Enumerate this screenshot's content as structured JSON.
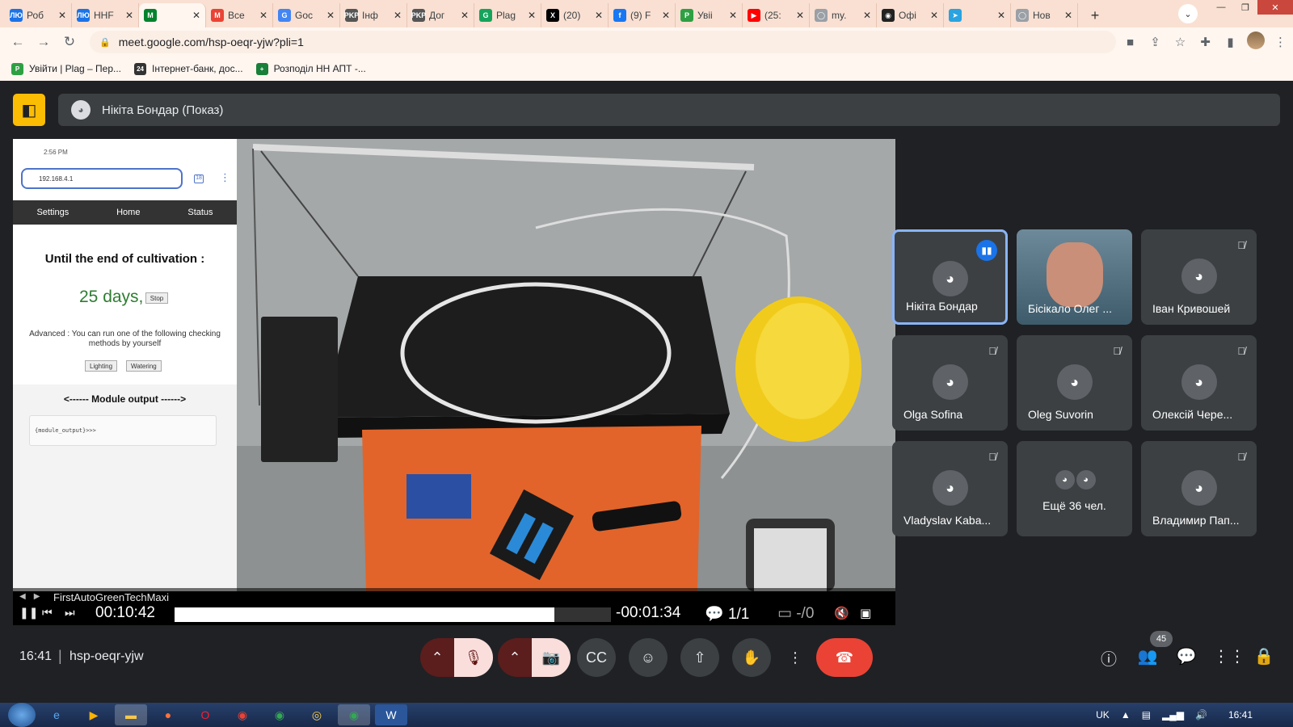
{
  "browser": {
    "tabs": [
      {
        "label": "Роб",
        "color": "#1a73e8",
        "glyph": "ЛЮ"
      },
      {
        "label": "HHF",
        "color": "#1a73e8",
        "glyph": "ЛЮ"
      },
      {
        "label": "",
        "color": "#00832d",
        "glyph": "M",
        "active": true
      },
      {
        "label": "Все",
        "color": "#ea4335",
        "glyph": "M"
      },
      {
        "label": "Goc",
        "color": "#4285f4",
        "glyph": "G"
      },
      {
        "label": "Інф",
        "color": "#555555",
        "glyph": "PKP"
      },
      {
        "label": "Дог",
        "color": "#555555",
        "glyph": "PKP"
      },
      {
        "label": "Plag",
        "color": "#15a45b",
        "glyph": "G"
      },
      {
        "label": "(20)",
        "color": "#000000",
        "glyph": "X"
      },
      {
        "label": "(9) F",
        "color": "#1877f2",
        "glyph": "f"
      },
      {
        "label": "Увіі",
        "color": "#2ea043",
        "glyph": "P"
      },
      {
        "label": "(25:",
        "color": "#ff0000",
        "glyph": "▶"
      },
      {
        "label": "my.",
        "color": "#9aa0a6",
        "glyph": "◯"
      },
      {
        "label": "Офі",
        "color": "#222222",
        "glyph": "◉"
      },
      {
        "label": "",
        "color": "#2aa3e0",
        "glyph": "➤"
      },
      {
        "label": "Нов",
        "color": "#9aa0a6",
        "glyph": "◯"
      }
    ],
    "url": "meet.google.com/hsp-oeqr-yjw?pli=1",
    "bookmarks": [
      {
        "label": "Увійти | Plag – Пер...",
        "color": "#2ea043",
        "glyph": "P"
      },
      {
        "label": "Інтернет-банк, дос...",
        "color": "#333333",
        "glyph": "24"
      },
      {
        "label": "Розподіл НН АПТ -...",
        "color": "#188038",
        "glyph": "+"
      }
    ]
  },
  "meet": {
    "presenter": "Нікіта Бондар (Показ)",
    "shared": {
      "phone_time": "2:56 PM",
      "url": "192.168.4.1",
      "tabs_count": "18",
      "nav": [
        "Settings",
        "Home",
        "Status"
      ],
      "until": "Until the end of cultivation :",
      "days": "25 days,",
      "stop": "Stop",
      "advanced": "Advanced : You can run one of the following checking methods by yourself",
      "lighting": "Lighting",
      "watering": "Watering",
      "module_output": "<------ Module output ------>",
      "module_text": "{module_output}>>>"
    },
    "player": {
      "title": "FirstAutoGreenTechMaxi",
      "elapsed": "00:10:42",
      "progress": 0.87,
      "remaining": "-00:01:34",
      "chapters": "1/1",
      "subtitles": "-/0"
    },
    "participants": [
      {
        "name": "Нікіта Бондар",
        "state": "speaking"
      },
      {
        "name": "Бісікало Олег ...",
        "state": "video"
      },
      {
        "name": "Іван Кривошей",
        "state": "muted"
      },
      {
        "name": "Olga Sofina",
        "state": "muted"
      },
      {
        "name": "Oleg Suvorin",
        "state": "muted"
      },
      {
        "name": "Олексій Чере...",
        "state": "muted"
      },
      {
        "name": "Vladyslav Kaba...",
        "state": "muted"
      },
      {
        "name": "Ещё 36 чел.",
        "state": "more"
      },
      {
        "name": "Владимир Пап...",
        "state": "muted"
      }
    ],
    "time": "16:41",
    "code": "hsp-oeqr-yjw",
    "people_count": "45"
  },
  "taskbar": {
    "lang": "UK",
    "time": "16:41"
  }
}
